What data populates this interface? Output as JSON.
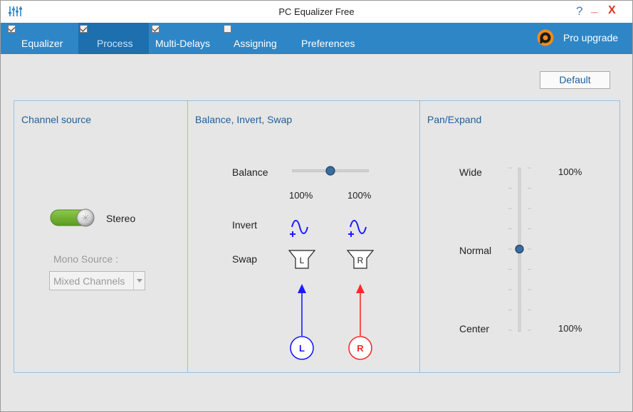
{
  "window": {
    "title": "PC Equalizer Free",
    "help_label": "?",
    "minimize_label": "_",
    "close_label": "X",
    "icons": {
      "app": "equalizer-sliders-icon",
      "pro": "pc-equalizer-logo-icon"
    }
  },
  "tabs": [
    {
      "label": "Equalizer",
      "checked": true,
      "active": false
    },
    {
      "label": "Process",
      "checked": true,
      "active": true
    },
    {
      "label": "Multi-Delays",
      "checked": true,
      "active": false
    },
    {
      "label": "Assigning",
      "checked": false,
      "active": false
    },
    {
      "label": "Preferences",
      "active": false
    }
  ],
  "pro_upgrade_label": "Pro upgrade",
  "default_button": "Default",
  "channel_source": {
    "title": "Channel source",
    "toggle_on": true,
    "toggle_label": "Stereo",
    "mono_source_label": "Mono Source :",
    "mono_source_value": "Mixed Channels",
    "mono_source_enabled": false
  },
  "balance_panel": {
    "title": "Balance, Invert, Swap",
    "balance_label": "Balance",
    "balance_value": 0.5,
    "left_pct": "100%",
    "right_pct": "100%",
    "invert_label": "Invert",
    "swap_label": "Swap",
    "swap_left": "L",
    "swap_right": "R",
    "channel_left": "L",
    "channel_right": "R",
    "colors": {
      "left": "#1a1aff",
      "right": "#ff2a2a",
      "knob": "#3d6b9e"
    }
  },
  "pan_panel": {
    "title": "Pan/Expand",
    "wide_label": "Wide",
    "normal_label": "Normal",
    "center_label": "Center",
    "wide_pct": "100%",
    "center_pct": "100%",
    "slider_value": 0.5
  },
  "colors": {
    "accent": "#2f86c6",
    "accent_active": "#1d6fae",
    "title_text": "#1d5f9c",
    "close": "#e0341f",
    "toggle_green": "#6fae2f"
  }
}
